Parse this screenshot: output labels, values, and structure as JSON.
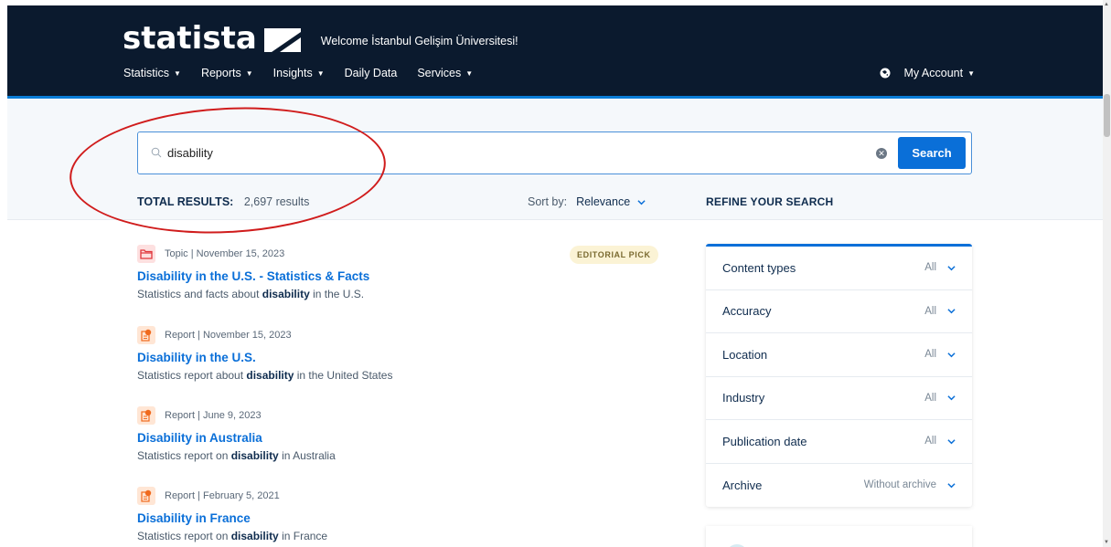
{
  "header": {
    "logo": "statista",
    "welcome": "Welcome İstanbul Gelişim Üniversitesi!",
    "nav": [
      {
        "label": "Statistics",
        "dropdown": true
      },
      {
        "label": "Reports",
        "dropdown": true
      },
      {
        "label": "Insights",
        "dropdown": true
      },
      {
        "label": "Daily Data",
        "dropdown": false
      },
      {
        "label": "Services",
        "dropdown": true
      }
    ],
    "account": "My Account"
  },
  "search": {
    "value": "disability",
    "button": "Search"
  },
  "results_bar": {
    "total_label": "TOTAL RESULTS:",
    "total_value": "2,697 results",
    "sort_label": "Sort by:",
    "sort_value": "Relevance",
    "refine_label": "REFINE YOUR SEARCH"
  },
  "editorial_pick": "EDITORIAL PICK",
  "results": [
    {
      "icon": "folder-icon",
      "meta": "Topic | November 15, 2023",
      "title": "Disability in the U.S. - Statistics & Facts",
      "desc_pre": "Statistics and facts about ",
      "desc_bold": "disability",
      "desc_post": " in the U.S."
    },
    {
      "icon": "report-icon",
      "meta": "Report | November 15, 2023",
      "title": "Disability in the U.S.",
      "desc_pre": "Statistics report about ",
      "desc_bold": "disability",
      "desc_post": " in the United States"
    },
    {
      "icon": "report-icon",
      "meta": "Report | June 9, 2023",
      "title": "Disability in Australia",
      "desc_pre": "Statistics report on ",
      "desc_bold": "disability",
      "desc_post": " in Australia"
    },
    {
      "icon": "report-icon",
      "meta": "Report | February 5, 2021",
      "title": "Disability in France",
      "desc_pre": "Statistics report on ",
      "desc_bold": "disability",
      "desc_post": " in France"
    }
  ],
  "filters": [
    {
      "label": "Content types",
      "value": "All"
    },
    {
      "label": "Accuracy",
      "value": "All"
    },
    {
      "label": "Location",
      "value": "All"
    },
    {
      "label": "Industry",
      "value": "All"
    },
    {
      "label": "Publication date",
      "value": "All"
    },
    {
      "label": "Archive",
      "value": "Without archive"
    }
  ],
  "colors": {
    "header_bg": "#0b1a2e",
    "accent": "#0a6fd8",
    "annotation": "#d01c1c"
  }
}
